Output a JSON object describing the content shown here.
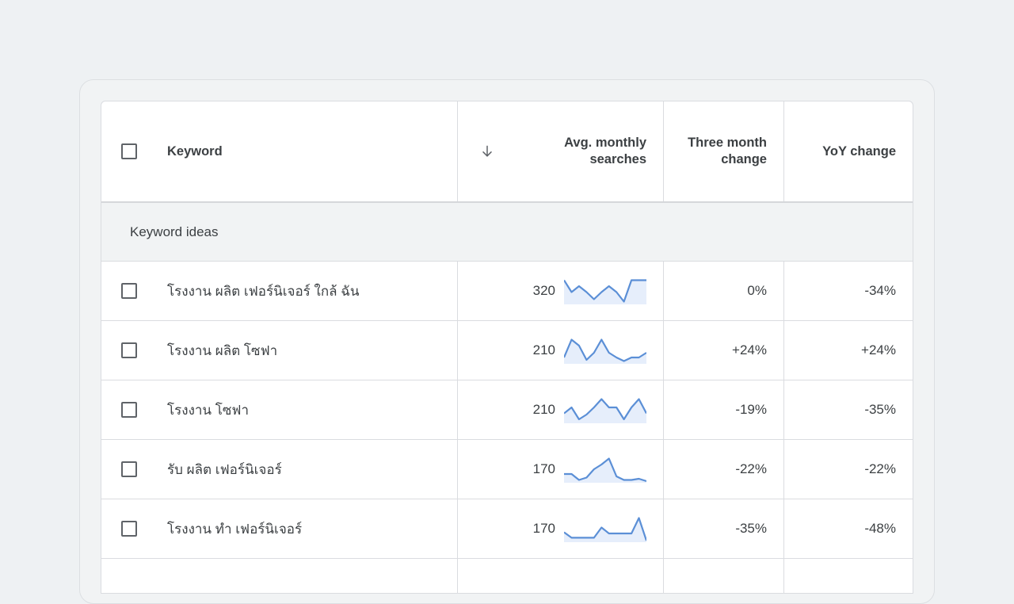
{
  "table": {
    "headers": {
      "keyword": "Keyword",
      "avg_line1": "Avg. monthly",
      "avg_line2": "searches",
      "three_month_line1": "Three month",
      "three_month_line2": "change",
      "yoy": "YoY change"
    },
    "sort_icon": "arrow-down-icon",
    "group_label": "Keyword ideas",
    "rows": [
      {
        "keyword": "โรงงาน ผลิต เฟอร์นิเจอร์ ใกล้ ฉัน",
        "avg": "320",
        "three_month": "0%",
        "yoy": "-34%",
        "trend": [
          0.95,
          0.45,
          0.7,
          0.45,
          0.15,
          0.45,
          0.7,
          0.45,
          0.05,
          0.95,
          0.95,
          0.95
        ]
      },
      {
        "keyword": "โรงงาน ผลิต โซฟา",
        "avg": "210",
        "three_month": "+24%",
        "yoy": "+24%",
        "trend": [
          0.2,
          0.95,
          0.7,
          0.1,
          0.4,
          0.95,
          0.4,
          0.2,
          0.05,
          0.2,
          0.2,
          0.4
        ]
      },
      {
        "keyword": "โรงงาน โซฟา",
        "avg": "210",
        "three_month": "-19%",
        "yoy": "-35%",
        "trend": [
          0.35,
          0.6,
          0.1,
          0.3,
          0.6,
          0.95,
          0.6,
          0.6,
          0.1,
          0.6,
          0.95,
          0.35
        ]
      },
      {
        "keyword": "รับ ผลิต เฟอร์นิเจอร์",
        "avg": "170",
        "three_month": "-22%",
        "yoy": "-22%",
        "trend": [
          0.3,
          0.3,
          0.05,
          0.15,
          0.5,
          0.7,
          0.95,
          0.2,
          0.05,
          0.05,
          0.1,
          0.0
        ]
      },
      {
        "keyword": "โรงงาน ทำ เฟอร์นิเจอร์",
        "avg": "170",
        "three_month": "-35%",
        "yoy": "-48%",
        "trend": [
          0.35,
          0.12,
          0.12,
          0.12,
          0.12,
          0.55,
          0.3,
          0.3,
          0.3,
          0.3,
          0.95,
          0.0
        ]
      }
    ]
  },
  "colors": {
    "spark_line": "#5b8fd6",
    "spark_fill": "#e6eefb",
    "border": "#dadce0"
  }
}
